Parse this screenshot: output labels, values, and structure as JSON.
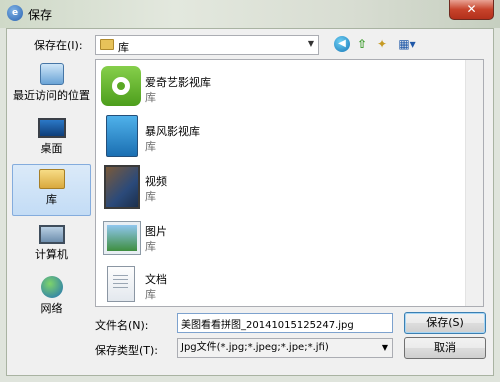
{
  "window": {
    "title": "保存",
    "close_label": "✕"
  },
  "toolbar": {
    "save_in_label": "保存在(I):",
    "location": "库",
    "back_icon": "back-icon",
    "up_icon": "up-folder-icon",
    "new_folder_icon": "new-folder-icon",
    "view_icon": "view-menu-icon"
  },
  "places": [
    {
      "label": "最近访问的位置",
      "icon": "recent-places-icon"
    },
    {
      "label": "桌面",
      "icon": "desktop-icon"
    },
    {
      "label": "库",
      "icon": "libraries-icon",
      "selected": true
    },
    {
      "label": "计算机",
      "icon": "computer-icon"
    },
    {
      "label": "网络",
      "icon": "network-icon"
    }
  ],
  "files": [
    {
      "name": "爱奇艺影视库",
      "type": "库",
      "icon": "iqiyi-library-icon"
    },
    {
      "name": "暴风影视库",
      "type": "库",
      "icon": "baofeng-library-icon"
    },
    {
      "name": "视频",
      "type": "库",
      "icon": "videos-library-icon"
    },
    {
      "name": "图片",
      "type": "库",
      "icon": "pictures-library-icon"
    },
    {
      "name": "文档",
      "type": "库",
      "icon": "documents-library-icon"
    }
  ],
  "form": {
    "filename_label": "文件名(N):",
    "filename_value": "美图看看拼图_20141015125247.jpg",
    "filetype_label": "保存类型(T):",
    "filetype_value": "Jpg文件(*.jpg;*.jpeg;*.jpe;*.jfi)",
    "save_button": "保存(S)",
    "cancel_button": "取消"
  }
}
